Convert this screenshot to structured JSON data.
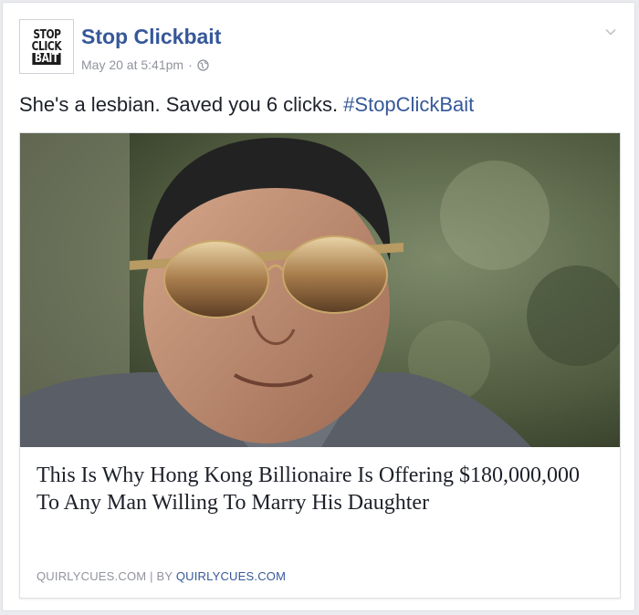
{
  "post": {
    "avatar": {
      "lines": [
        "STOP",
        "CLICK",
        "BAIT"
      ]
    },
    "page_name": "Stop Clickbait",
    "timestamp": "May 20 at 5:41pm",
    "separator": "·",
    "privacy_icon": "globe-icon",
    "options_icon": "chevron-down-icon",
    "text": "She's a lesbian. Saved you 6 clicks. ",
    "hashtag": "#StopClickBait"
  },
  "link": {
    "image_description_icon": "article-photo",
    "title": "This Is Why Hong Kong Billionaire Is Offering $180,000,000 To Any Man Willing To Marry His Daughter",
    "domain": "QUIRLYCUES.COM",
    "divider": "|",
    "by_label": "BY",
    "author": "QUIRLYCUES.COM"
  },
  "colors": {
    "link_blue": "#365899",
    "meta_gray": "#90949c",
    "text_dark": "#1d2129",
    "card_border": "#dddfe2"
  }
}
